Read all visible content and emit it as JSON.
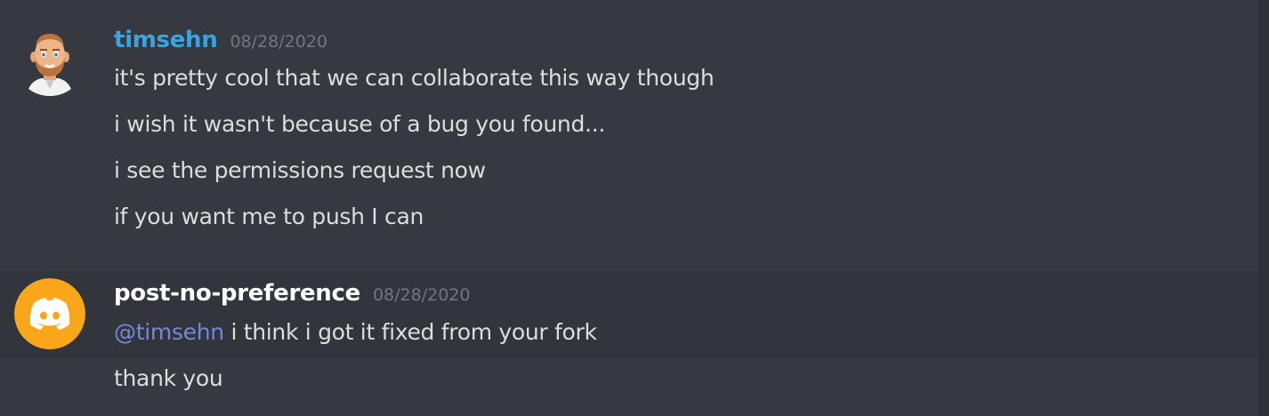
{
  "messages": [
    {
      "username": "timsehn",
      "username_color": "#3ba4e0",
      "timestamp": "08/28/2020",
      "avatar_icon": "bearded-man-bitmoji-icon",
      "lines": [
        "it's pretty cool that we can collaborate this way though",
        "i wish it wasn't because of a bug you found...",
        "i see the permissions request now",
        "if you want me to push I can"
      ]
    },
    {
      "username": "post-no-preference",
      "username_color": "#ffffff",
      "timestamp": "08/28/2020",
      "avatar_icon": "discord-logo-icon",
      "avatar_color": "#faa61a",
      "mention": "@timsehn",
      "lines": [
        " i think i got it fixed from your fork",
        "thank you"
      ]
    }
  ]
}
